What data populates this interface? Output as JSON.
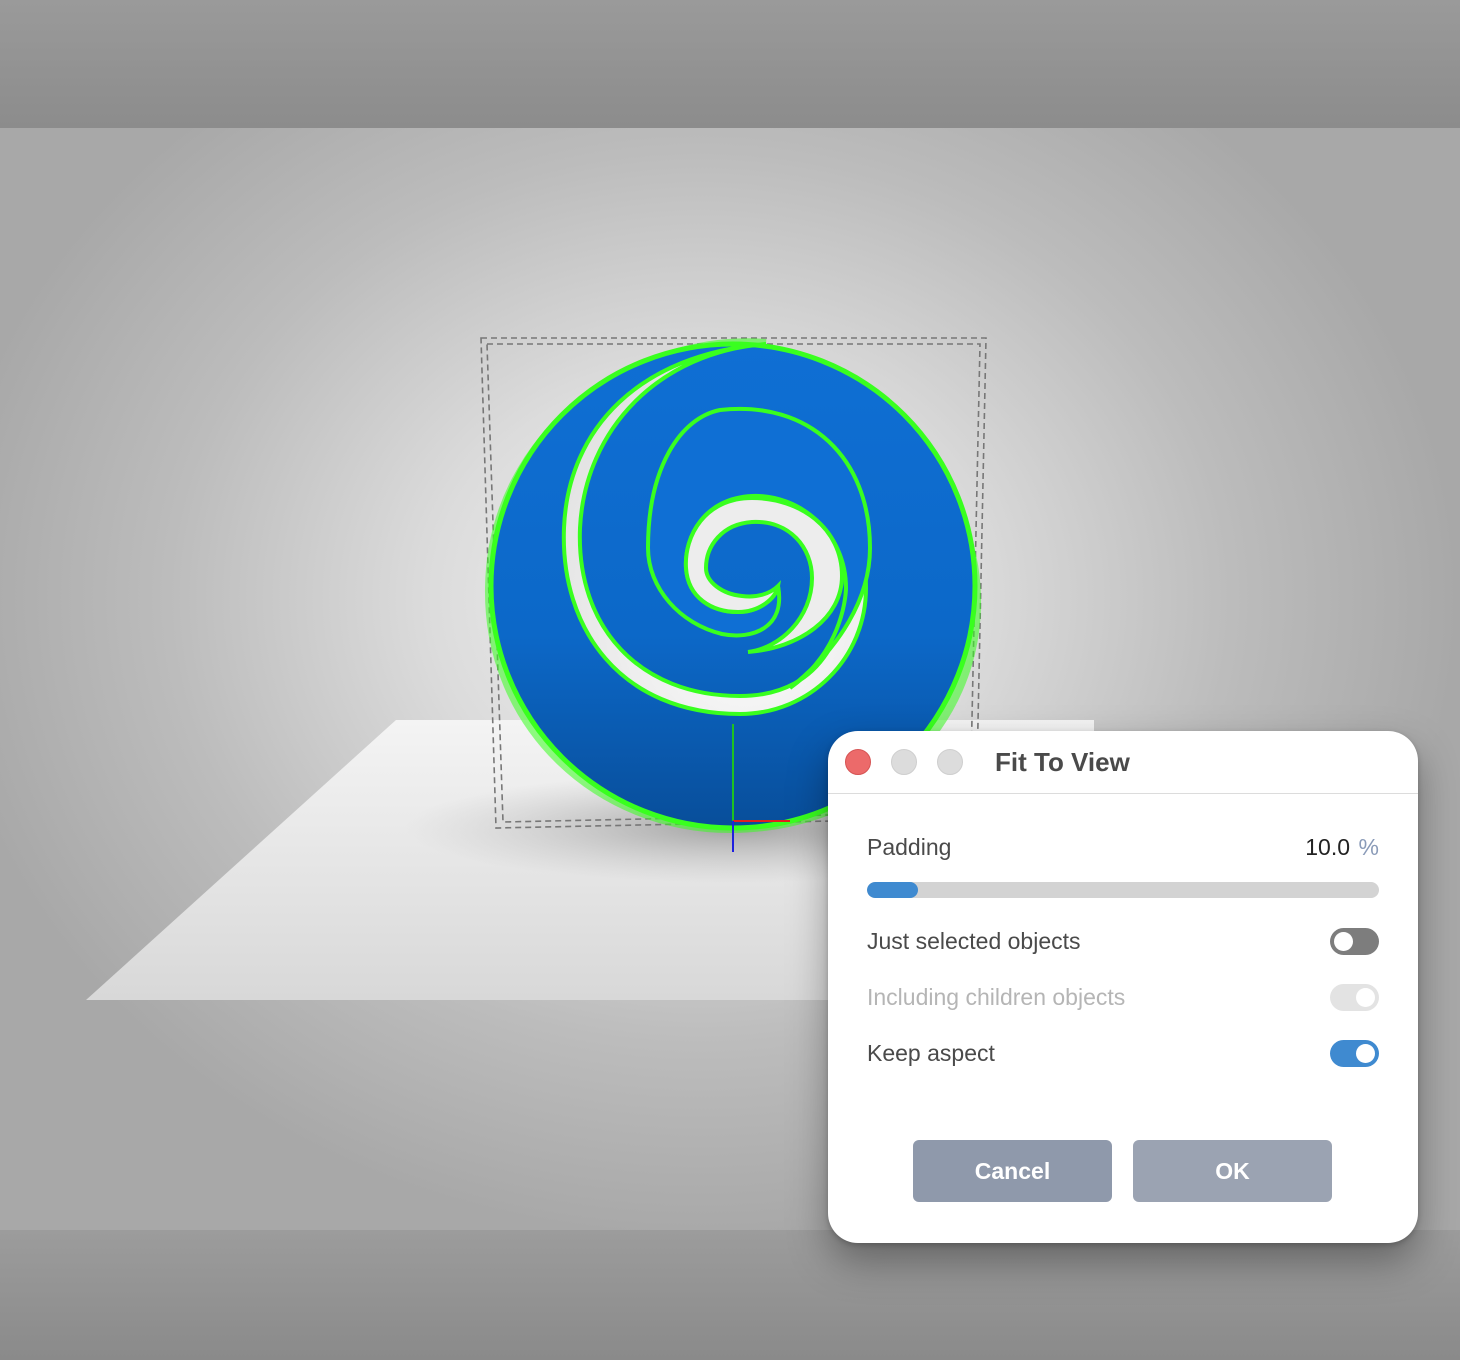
{
  "dialog": {
    "title": "Fit To View",
    "window_controls": {
      "close": "close-icon",
      "minimize": "minimize-icon",
      "maximize": "maximize-icon"
    },
    "padding": {
      "label": "Padding",
      "value": "10.0",
      "unit": "%",
      "slider_fraction": 0.1
    },
    "options": {
      "just_selected": {
        "label": "Just selected objects",
        "checked": false,
        "enabled": true
      },
      "including_children": {
        "label": "Including children objects",
        "checked": true,
        "enabled": false
      },
      "keep_aspect": {
        "label": "Keep aspect",
        "checked": true,
        "enabled": true
      }
    },
    "buttons": {
      "cancel": "Cancel",
      "ok": "OK"
    }
  },
  "scene": {
    "object": "blue-spiral-logo",
    "selection_highlight": "#39ff1f",
    "object_color": "#0c6dd1",
    "axis_colors": {
      "x": "#e01f1f",
      "y": "#1fc21f",
      "z": "#1f1fe0"
    }
  },
  "colors": {
    "accent": "#3f8ad0",
    "close_button": "#ec6a6a",
    "button_gray": "#8f99ab"
  }
}
